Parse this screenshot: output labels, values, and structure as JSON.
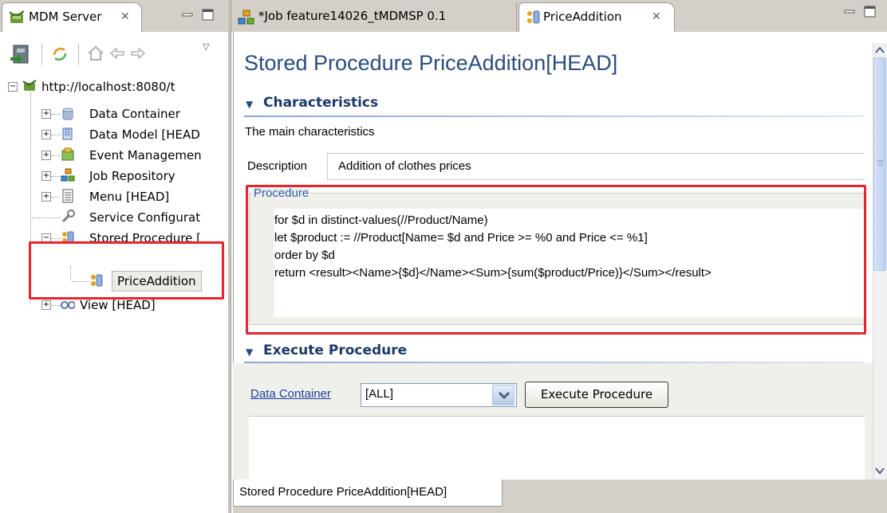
{
  "left_view": {
    "tab_title": "MDM Server",
    "tree": {
      "server": "http://localhost:8080/t",
      "items": [
        {
          "label": "Data Container"
        },
        {
          "label": "Data Model [HEAD"
        },
        {
          "label": "Event Managemen"
        },
        {
          "label": "Job Repository"
        },
        {
          "label": "Menu [HEAD]"
        },
        {
          "label": "Service Configurat"
        },
        {
          "label": "Stored Procedure [",
          "children": [
            {
              "label": "PriceAddition"
            }
          ]
        },
        {
          "label": "View [HEAD]"
        }
      ]
    }
  },
  "editor_tabs": [
    {
      "label": "*Job feature14026_tMDMSP 0.1"
    },
    {
      "label": "PriceAddition"
    }
  ],
  "editor": {
    "title": "Stored Procedure PriceAddition[HEAD]",
    "characteristics": {
      "heading": "Characteristics",
      "subtitle": "The main characteristics",
      "description_label": "Description",
      "description_value": "Addition of clothes prices"
    },
    "procedure": {
      "label": "Procedure",
      "lines": [
        "for $d in distinct-values(//Product/Name)",
        "let $product := //Product[Name= $d and Price >= %0 and Price <= %1]",
        "order by $d",
        "return <result><Name>{$d}</Name><Sum>{sum($product/Price)}</Sum></result>"
      ]
    },
    "execute": {
      "heading": "Execute Procedure",
      "data_container_label": "Data Container",
      "data_container_value": "[ALL]",
      "execute_button": "Execute Procedure"
    },
    "bottom_tab": "Stored Procedure PriceAddition[HEAD]"
  },
  "colors": {
    "title": "#2b4c80",
    "highlight_border": "#e8242c",
    "chrome": "#d4d0c8"
  }
}
